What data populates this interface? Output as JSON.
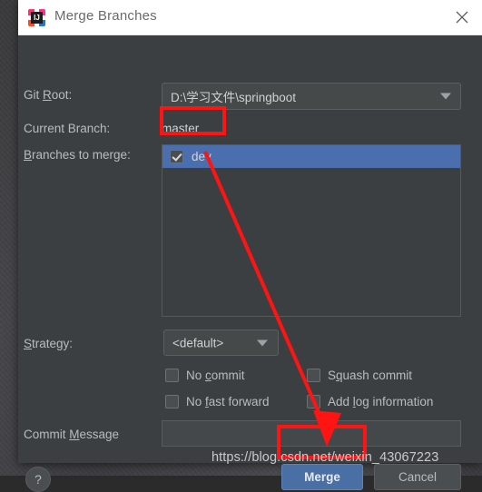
{
  "window": {
    "title": "Merge Branches",
    "icon": "intellij-idea-logo",
    "close_icon": "close-icon"
  },
  "form": {
    "git_root": {
      "label_prefix": "Git ",
      "label_mnemonic": "R",
      "label_suffix": "oot:",
      "label_full": "Git Root:",
      "value": "D:\\学习文件\\springboot"
    },
    "current_branch": {
      "label": "Current Branch:",
      "value": "master"
    },
    "branches_to_merge": {
      "label_prefix": "",
      "label_mnemonic": "B",
      "label_suffix": "ranches to merge:",
      "label_full": "Branches to merge:",
      "items": [
        {
          "name": "dev",
          "checked": true,
          "selected": true
        }
      ]
    },
    "strategy": {
      "label_prefix": "",
      "label_mnemonic": "S",
      "label_suffix": "trategy:",
      "label_full": "Strategy:",
      "value": "<default>",
      "options": [
        "<default>"
      ]
    },
    "options": [
      {
        "id": "no-commit",
        "prefix": "No ",
        "mnemonic": "c",
        "suffix": "ommit",
        "label": "No commit",
        "checked": false
      },
      {
        "id": "squash-commit",
        "prefix": "S",
        "mnemonic": "q",
        "suffix": "uash commit",
        "label": "Squash commit",
        "checked": false
      },
      {
        "id": "no-fast-forward",
        "prefix": "No ",
        "mnemonic": "f",
        "suffix": "ast forward",
        "label": "No fast forward",
        "checked": false
      },
      {
        "id": "add-log-info",
        "prefix": "Add ",
        "mnemonic": "l",
        "suffix": "og information",
        "label": "Add log information",
        "checked": false
      }
    ],
    "commit_message": {
      "label_prefix": "Commit ",
      "label_mnemonic": "M",
      "label_suffix": "essage",
      "label_full": "Commit Message",
      "value": "",
      "placeholder": ""
    }
  },
  "footer": {
    "help_label": "?",
    "merge_label": "Merge",
    "cancel_label": "Cancel"
  },
  "watermark": {
    "text": "https://blog.csdn.net/weixin_43067223"
  },
  "annotation": {
    "color": "#ff1414",
    "arrow_from": "branch-checkbox",
    "arrow_to": "merge-button"
  }
}
